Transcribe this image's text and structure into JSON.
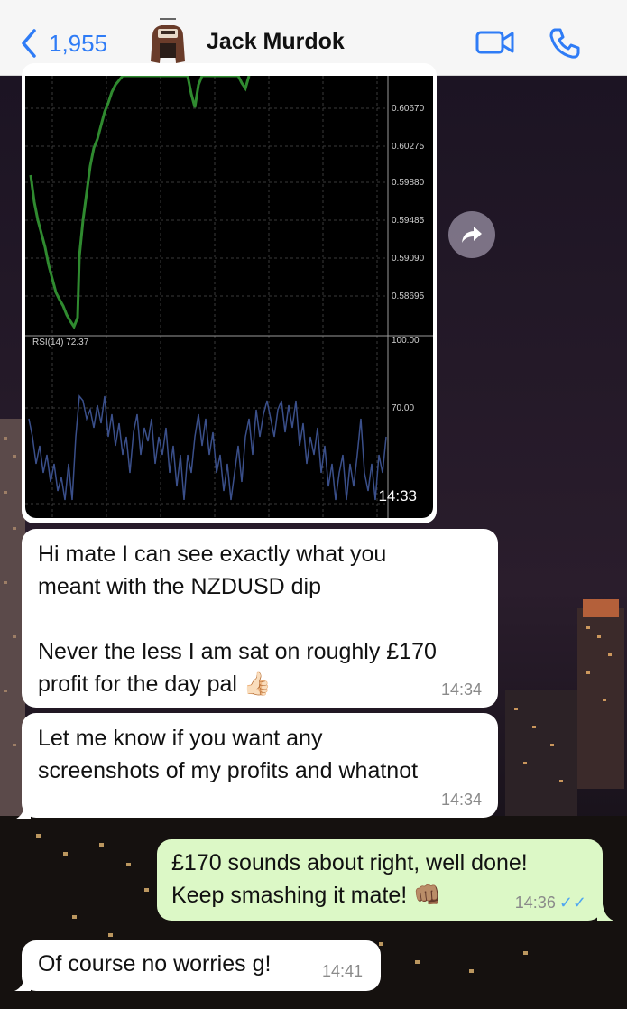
{
  "header": {
    "back_count": "1,955",
    "contact_name": "Jack Murdok",
    "accent": "#2f7cf6"
  },
  "icons": [
    "chevron-left-icon",
    "video-call-icon",
    "phone-icon",
    "share-forward-icon"
  ],
  "chart": {
    "price_ticks": [
      "0.60670",
      "0.60275",
      "0.59880",
      "0.59485",
      "0.59090",
      "0.58695"
    ],
    "rsi_label": "RSI(14) 72.37",
    "rsi_ticks": [
      "100.00",
      "70.00"
    ],
    "time": "14:33"
  },
  "messages": [
    {
      "dir": "in",
      "text": "Hi mate I can see exactly what you\nmeant with the NZDUSD dip\n\nNever the less I am sat on roughly £170\nprofit for the day pal 👍🏻",
      "time": "14:34"
    },
    {
      "dir": "in",
      "text": "Let me know if you want any\nscreenshots of my profits and whatnot",
      "time": "14:34"
    },
    {
      "dir": "out",
      "text": "£170 sounds about right, well done!\nKeep smashing it mate! 👊🏽",
      "time": "14:36",
      "read": "✓✓"
    },
    {
      "dir": "in",
      "text": "Of course no worries g!",
      "time": "14:41"
    }
  ]
}
